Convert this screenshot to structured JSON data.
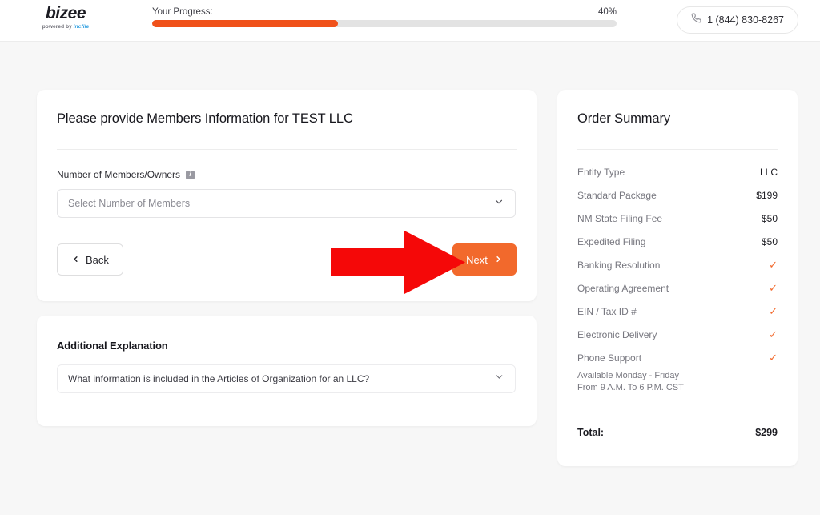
{
  "header": {
    "logo_main": "bizee",
    "logo_sub_prefix": "powered by ",
    "logo_sub_brand": "incfile",
    "progress_label": "Your Progress:",
    "progress_percent": "40%",
    "progress_value": 40,
    "phone_icon": "phone-icon",
    "phone_number": "1 (844) 830-8267"
  },
  "form": {
    "title": "Please provide Members Information for TEST LLC",
    "field_label": "Number of Members/Owners",
    "info_icon": "info-icon",
    "info_glyph": "i",
    "select_placeholder": "Select Number of Members",
    "chevron_down_icon": "chevron-down-icon",
    "back_label": "Back",
    "back_icon": "chevron-left-icon",
    "next_label": "Next",
    "next_icon": "chevron-right-icon"
  },
  "explanation": {
    "title": "Additional Explanation",
    "question": "What information is included in the Articles of Organization for an LLC?",
    "chevron_down_icon": "chevron-down-icon"
  },
  "summary": {
    "title": "Order Summary",
    "rows": [
      {
        "label": "Entity Type",
        "value": "LLC",
        "type": "text"
      },
      {
        "label": "Standard Package",
        "value": "$199",
        "type": "text"
      },
      {
        "label": "NM State Filing Fee",
        "value": "$50",
        "type": "text"
      },
      {
        "label": "Expedited Filing",
        "value": "$50",
        "type": "text"
      },
      {
        "label": "Banking Resolution",
        "value": "✓",
        "type": "check"
      },
      {
        "label": "Operating Agreement",
        "value": "✓",
        "type": "check"
      },
      {
        "label": "EIN / Tax ID #",
        "value": "✓",
        "type": "check"
      },
      {
        "label": "Electronic Delivery",
        "value": "✓",
        "type": "check"
      },
      {
        "label": "Phone Support",
        "value": "✓",
        "type": "check"
      }
    ],
    "availability_line1": "Available Monday - Friday",
    "availability_line2": "From 9 A.M. To 6 P.M. CST",
    "total_label": "Total:",
    "total_value": "$299"
  },
  "annotation": {
    "arrow_icon": "red-arrow-annotation",
    "arrow_color": "#f50808",
    "points_to": "Next"
  },
  "colors": {
    "accent_orange": "#f2692c",
    "progress_orange": "#f0511a",
    "page_background": "#f7f7f7",
    "card_background": "#ffffff",
    "brand_blue": "#2f9fe0"
  }
}
